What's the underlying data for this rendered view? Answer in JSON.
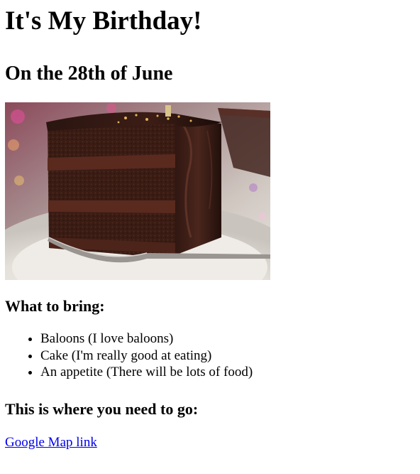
{
  "page": {
    "heading": "It's My Birthday!",
    "date": "On the 28th of June",
    "image": {
      "subject": "slice-of-chocolate-layer-cake"
    },
    "bring": {
      "title": "What to bring:",
      "items": [
        "Baloons (I love baloons)",
        "Cake (I'm really good at eating)",
        "An appetite (There will be lots of food)"
      ]
    },
    "directions": {
      "title": "This is where you need to go:",
      "link_text": "Google Map link"
    }
  },
  "colors": {
    "link": "#0000ee",
    "text": "#000000"
  }
}
